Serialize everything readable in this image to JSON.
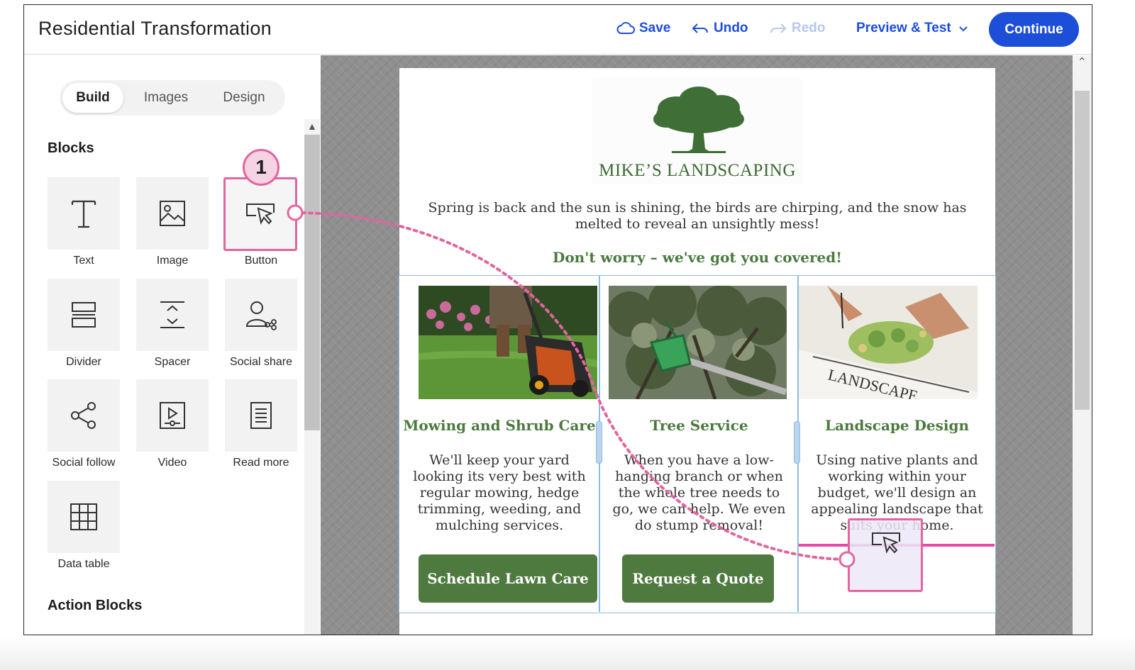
{
  "header": {
    "title": "Residential Transformation",
    "save_label": "Save",
    "undo_label": "Undo",
    "redo_label": "Redo",
    "preview_label": "Preview & Test",
    "continue_label": "Continue"
  },
  "left_panel": {
    "tabs": [
      {
        "label": "Build",
        "active": true
      },
      {
        "label": "Images",
        "active": false
      },
      {
        "label": "Design",
        "active": false
      }
    ],
    "blocks_title": "Blocks",
    "blocks": [
      {
        "label": "Text",
        "icon": "text-icon"
      },
      {
        "label": "Image",
        "icon": "image-icon"
      },
      {
        "label": "Button",
        "icon": "button-cursor-icon"
      },
      {
        "label": "Divider",
        "icon": "divider-icon"
      },
      {
        "label": "Spacer",
        "icon": "spacer-icon"
      },
      {
        "label": "Social share",
        "icon": "social-share-icon"
      },
      {
        "label": "Social follow",
        "icon": "social-follow-icon"
      },
      {
        "label": "Video",
        "icon": "video-icon"
      },
      {
        "label": "Read more",
        "icon": "read-more-icon"
      },
      {
        "label": "Data table",
        "icon": "data-table-icon"
      }
    ],
    "action_blocks_title": "Action Blocks"
  },
  "annotation": {
    "step_number": "1",
    "color": "#e2659e"
  },
  "email": {
    "logo_text": "MIKE’S LANDSCAPING",
    "intro": "Spring is back and the sun is shining, the birds are chirping, and the snow has melted to reveal an unsightly mess!",
    "tagline": "Don't worry – we've got you covered!",
    "columns": [
      {
        "heading": "Mowing and Shrub Care",
        "body": "We'll keep your yard looking its very best with regular mowing, hedge trimming, weeding, and mulching services.",
        "button": "Schedule Lawn Care",
        "photo": "lawn-mower-photo"
      },
      {
        "heading": "Tree Service",
        "body": "When you have a low-hanging branch or when the whole tree needs to go, we can help. We even do stump removal!",
        "button": "Request a Quote",
        "photo": "tree-bucket-lift-photo"
      },
      {
        "heading": "Landscape Design",
        "body": "Using native plants and working within your budget, we'll design an appealing landscape that suits your home.",
        "button": "",
        "photo": "landscape-plan-photo"
      }
    ]
  },
  "colors": {
    "brand_blue": "#1d4ed8",
    "green_heading": "#4a7a3d",
    "cta_green": "#4e7a3f",
    "highlight_pink": "#e2659e"
  }
}
